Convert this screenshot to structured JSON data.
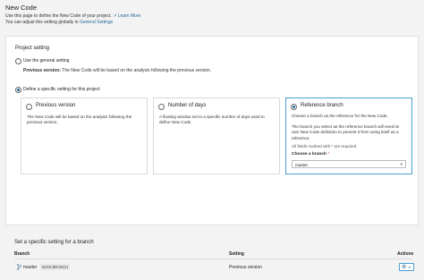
{
  "header": {
    "title": "New Code",
    "desc_line1": "Use this page to define the New Code of your project.",
    "learn_more": "Learn More",
    "desc_line2_prefix": "You can adjust this setting globally in",
    "general_settings_link": "General Settings"
  },
  "project_setting": {
    "title": "Project setting",
    "use_general_label": "Use the general setting",
    "previous_version_label": "Previous version:",
    "previous_version_note": "The New Code will be based on the analysis following the previous version.",
    "define_specific_label": "Define a specific setting for this project",
    "selected_option": "reference_branch"
  },
  "cards": {
    "previous_version": {
      "title": "Previous version",
      "desc": "The New Code will be based on the analysis following the previous version."
    },
    "number_of_days": {
      "title": "Number of days",
      "desc": "A floating window set to a specific number of days used to define New Code."
    },
    "reference_branch": {
      "title": "Reference branch",
      "desc1": "Choose a branch as the reference for the New Code.",
      "desc2": "The branch you select as the reference branch will need its own New Code definition to prevent it from using itself as a reference.",
      "required_note": "All fields marked with * are required",
      "choose_label": "Choose a branch",
      "required_star": "*",
      "selected_value": "master"
    }
  },
  "branch_section": {
    "title": "Set a specific setting for a branch",
    "columns": {
      "branch": "Branch",
      "setting": "Setting",
      "actions": "Actions"
    },
    "rows": [
      {
        "branch": "master",
        "badge": "MAIN BRANCH",
        "setting": "Previous version"
      }
    ]
  },
  "icons": {
    "external_link": "external-link-icon",
    "branch": "branch-icon",
    "gear": "gear-icon",
    "dropdown": "chevron-down-icon"
  },
  "colors": {
    "accent": "#236a97",
    "selected_border": "#4b9fd5",
    "required": "#d02f3a"
  }
}
